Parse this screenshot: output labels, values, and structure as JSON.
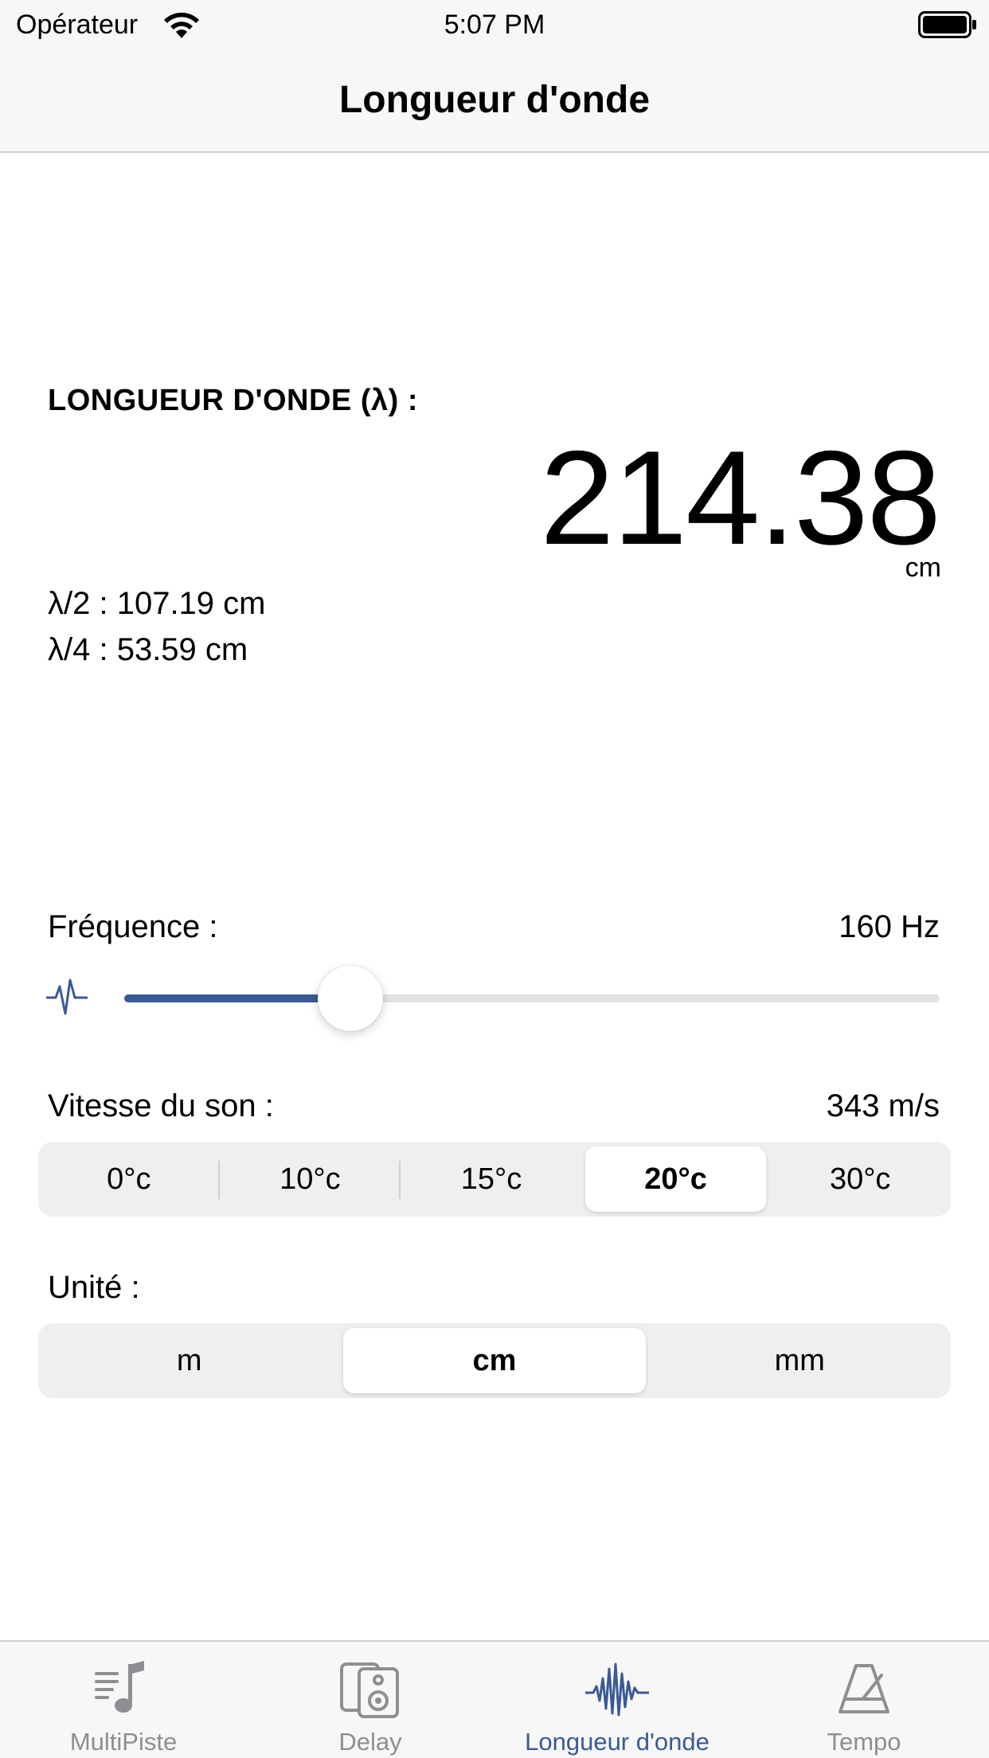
{
  "status": {
    "carrier": "Opérateur",
    "time": "5:07 PM"
  },
  "nav": {
    "title": "Longueur d'onde"
  },
  "wavelength": {
    "label": "LONGUEUR D'ONDE (λ) :",
    "value": "214.38",
    "unit": "cm",
    "half": "λ/2 : 107.19 cm",
    "quarter": "λ/4 : 53.59 cm"
  },
  "frequency": {
    "label": "Fréquence :",
    "value": "160 Hz",
    "slider_fraction": 0.277
  },
  "speed": {
    "label": "Vitesse du son :",
    "value": "343 m/s",
    "options": [
      "0°c",
      "10°c",
      "15°c",
      "20°c",
      "30°c"
    ],
    "selected": "20°c"
  },
  "unit": {
    "label": "Unité :",
    "options": [
      "m",
      "cm",
      "mm"
    ],
    "selected": "cm"
  },
  "tabs": [
    {
      "label": "MultiPiste",
      "icon": "music-list-icon",
      "active": false
    },
    {
      "label": "Delay",
      "icon": "speaker-icon",
      "active": false
    },
    {
      "label": "Longueur d'onde",
      "icon": "waveform-icon",
      "active": true
    },
    {
      "label": "Tempo",
      "icon": "metronome-icon",
      "active": false
    }
  ],
  "colors": {
    "accent": "#3a5a95",
    "inactive": "#8e8e93"
  }
}
